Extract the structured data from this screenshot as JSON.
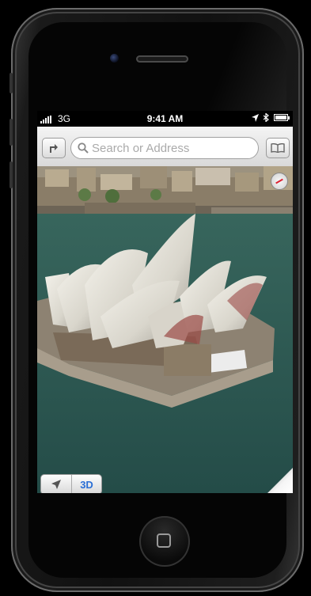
{
  "status_bar": {
    "network": "3G",
    "time": "9:41 AM"
  },
  "toolbar": {
    "search_placeholder": "Search or Address"
  },
  "map_controls": {
    "three_d_label": "3D"
  },
  "colors": {
    "accent": "#2a6fd6",
    "water": "#2c5a55"
  },
  "icons": [
    "signal-bars-icon",
    "location-arrow-icon",
    "bluetooth-icon",
    "battery-icon",
    "directions-arrow-icon",
    "search-icon",
    "bookmarks-book-icon",
    "compass-icon",
    "current-location-icon",
    "page-curl-icon"
  ]
}
